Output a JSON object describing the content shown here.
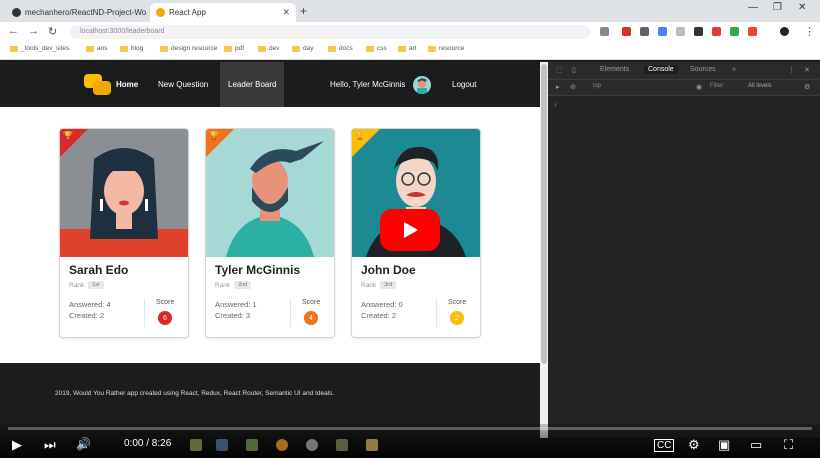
{
  "browser": {
    "tabs": [
      {
        "label": "mechanhero/ReactND-Project-Wo"
      },
      {
        "label": "React App"
      }
    ],
    "address": "localhost:3000/leaderboard",
    "bookmarks": [
      "_tools_dev_sites",
      "ans",
      "blog",
      "design resource",
      "pdf",
      "dev",
      "day",
      "docs",
      "css",
      "art",
      "resource"
    ]
  },
  "app": {
    "nav": {
      "home": "Home",
      "new_question": "New Question",
      "leader_board": "Leader Board",
      "hello": "Hello, Tyler McGinnis",
      "logout": "Logout"
    },
    "cards": [
      {
        "name": "Sarah Edo",
        "rank_label": "Rank",
        "rank_value": "1st",
        "answered": "Answered: 4",
        "created": "Created: 2",
        "score_label": "Score",
        "score": "6",
        "ribbon_color": "#db2828",
        "score_color": "#db2828"
      },
      {
        "name": "Tyler McGinnis",
        "rank_label": "Rank",
        "rank_value": "2nd",
        "answered": "Answered: 1",
        "created": "Created: 3",
        "score_label": "Score",
        "score": "4",
        "ribbon_color": "#f2711c",
        "score_color": "#f2711c"
      },
      {
        "name": "John Doe",
        "rank_label": "Rank",
        "rank_value": "3rd",
        "answered": "Answered: 0",
        "created": "Created: 2",
        "score_label": "Score",
        "score": "2",
        "ribbon_color": "#fbbd08",
        "score_color": "#fbbd08"
      }
    ],
    "footer": "2019, Would You Rather app created using React, Redux, React Router, Semantic UI and Ideals."
  },
  "devtools": {
    "tabs": [
      "Elements",
      "Console",
      "Sources"
    ],
    "active_tab": "Console",
    "context": "top",
    "filter_placeholder": "Filter",
    "levels": "All levels"
  },
  "player": {
    "current_time": "0:00",
    "duration": "8:26",
    "time_display": "0:00 / 8:26",
    "progress_fraction": 0.0
  }
}
